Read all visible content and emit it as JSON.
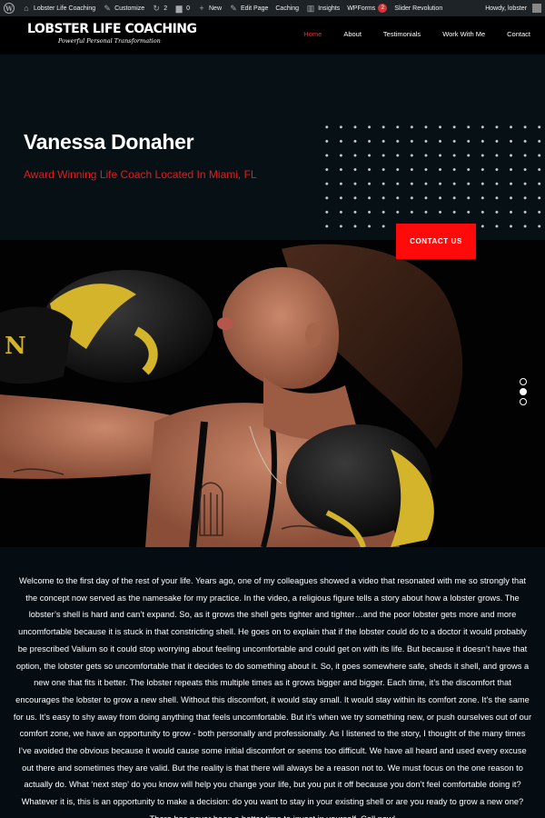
{
  "admin_bar": {
    "site_name": "Lobster Life Coaching",
    "customize": "Customize",
    "updates_count": "2",
    "comments_count": "0",
    "new": "New",
    "edit_page": "Edit Page",
    "caching": "Caching",
    "insights": "Insights",
    "wpforms": "WPForms",
    "wpforms_badge": "2",
    "slider": "Slider Revolution",
    "howdy": "Howdy, lobster"
  },
  "header": {
    "logo_title": "LOBSTER LIFE COACHING",
    "logo_tagline": "Powerful Personal Transformation",
    "nav": [
      {
        "label": "Home",
        "active": true
      },
      {
        "label": "About",
        "active": false
      },
      {
        "label": "Testimonials",
        "active": false
      },
      {
        "label": "Work With Me",
        "active": false
      },
      {
        "label": "Contact",
        "active": false
      }
    ]
  },
  "hero": {
    "name": "Vanessa Donaher",
    "subtitle": "Award Winning Life Coach Located In Miami, FL",
    "button": "CONTACT US",
    "slides": 3,
    "active_slide": 2,
    "accent_color": "#ff0a0a"
  },
  "intro_text": "Welcome to the first day of the rest of your life. Years ago, one of my colleagues showed a video that resonated with me so strongly that the concept now served as the namesake for my practice. In the video, a religious figure tells a story about how a lobster grows. The lobster’s shell is hard and can’t expand. So, as it grows the shell gets tighter and tighter…and the poor lobster gets more and more uncomfortable because it is stuck in that constricting shell. He goes on to explain that if the lobster could do to a doctor it would probably be prescribed Valium so it could stop worrying about feeling uncomfortable and could get on with its life. But because it doesn’t have that option, the lobster gets so uncomfortable that it decides to do something about it. So, it goes somewhere safe, sheds it shell, and grows a new one that fits it better. The lobster repeats this multiple times as it grows bigger and bigger. Each time, it’s the discomfort that encourages the lobster to grow a new shell. Without this discomfort, it would stay small. It would stay within its comfort zone. It’s the same for us. It’s easy to shy away from doing anything that feels uncomfortable. But it’s when we try something new, or push ourselves out of our comfort zone, we have an opportunity to grow - both personally and professionally. As I listened to the story, I thought of the many times I’ve avoided the obvious because it would cause some initial discomfort or seems too difficult. We have all heard and used every excuse out there and sometimes they are valid. But the reality is that there will always be a reason not to. We must focus on the one reason to actually do. What ‘next step’ do you know will help you change your life, but you put it off because you don’t feel comfortable doing it? Whatever it is, this is an opportunity to make a decision: do you want to stay in your existing shell or are you ready to grow a new one? There has never been a better time to invest in yourself. Call now!"
}
